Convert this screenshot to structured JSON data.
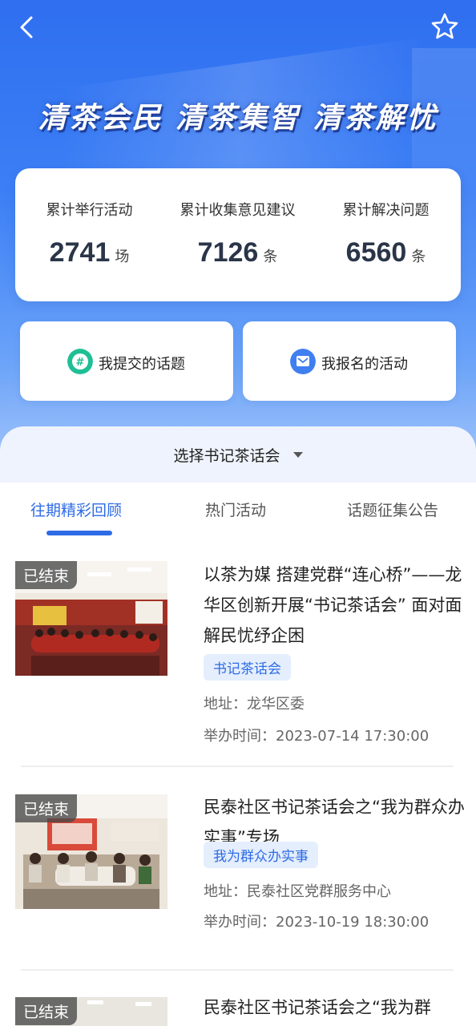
{
  "header": {
    "back_icon": "chevron-left-icon",
    "favorite_icon": "star-outline-icon",
    "slogan": "清茶会民 清茶集智 清茶解忧"
  },
  "stats": [
    {
      "label": "累计举行活动",
      "value": "2741",
      "unit": "场"
    },
    {
      "label": "累计收集意见建议",
      "value": "7126",
      "unit": "条"
    },
    {
      "label": "累计解决问题",
      "value": "6560",
      "unit": "条"
    }
  ],
  "quick_actions": [
    {
      "label": "我提交的话题",
      "icon": "topic-icon",
      "color": "#1fbf95"
    },
    {
      "label": "我报名的活动",
      "icon": "message-flag-icon",
      "color": "#3f7ff0"
    }
  ],
  "selector": {
    "label": "选择书记茶话会"
  },
  "tabs": [
    {
      "label": "往期精彩回顾",
      "active": true
    },
    {
      "label": "热门活动",
      "active": false
    },
    {
      "label": "话题征集公告",
      "active": false
    }
  ],
  "activities": [
    {
      "status": "已结束",
      "title": "以茶为媒 搭建党群“连心桥”——龙华区创新开展“书记茶话会” 面对面解民忧纾企困",
      "tag": "书记茶话会",
      "address": "地址：龙华区委",
      "time": "举办时间：2023-07-14 17:30:00"
    },
    {
      "status": "已结束",
      "title": "民泰社区书记茶话会之“我为群众办实事”专场",
      "tag": "我为群众办实事",
      "address": "地址：民泰社区党群服务中心",
      "time": "举办时间：2023-10-19 18:30:00"
    },
    {
      "status": "已结束",
      "title": "民泰社区书记茶话会之“我为群"
    }
  ],
  "colors": {
    "accent": "#2e6be6",
    "hero_top": "#2f6ff0",
    "stat_value": "#2a3548"
  }
}
